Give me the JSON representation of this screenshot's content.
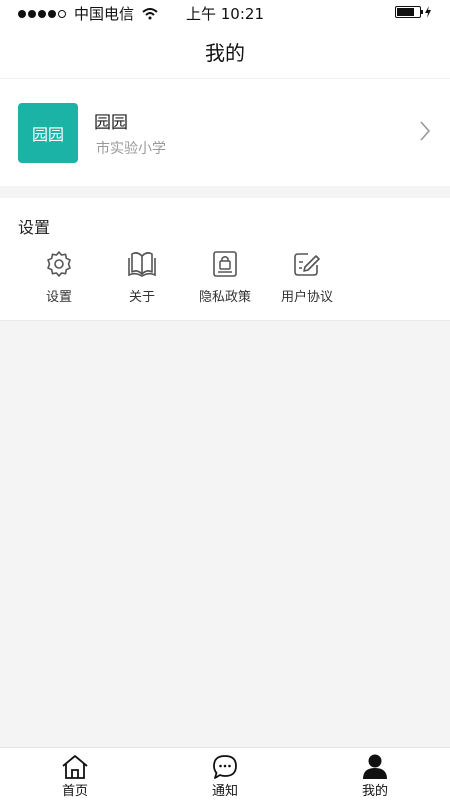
{
  "status_bar": {
    "carrier": "中国电信",
    "time": "上午 10:21",
    "battery_level": 0.75,
    "signal_strength": "4 of 5",
    "icons": [
      "signal-dots-icon",
      "wifi-icon",
      "battery-icon",
      "charging-bolt-icon"
    ]
  },
  "nav": {
    "title": "我的"
  },
  "profile": {
    "avatar_text": "园园",
    "avatar_color": "#1ab3a6",
    "name": "园园",
    "school": "市实验小学",
    "icon": "chevron-right-icon"
  },
  "settings": {
    "title": "设置",
    "items": [
      {
        "label": "设置",
        "icon": "gear-icon"
      },
      {
        "label": "关于",
        "icon": "book-icon"
      },
      {
        "label": "隐私政策",
        "icon": "privacy-lock-icon"
      },
      {
        "label": "用户协议",
        "icon": "agreement-edit-icon"
      }
    ]
  },
  "tabs": [
    {
      "label": "首页",
      "icon": "home-icon"
    },
    {
      "label": "通知",
      "icon": "chat-bubble-icon"
    },
    {
      "label": "我的",
      "icon": "user-icon",
      "active": true
    }
  ]
}
